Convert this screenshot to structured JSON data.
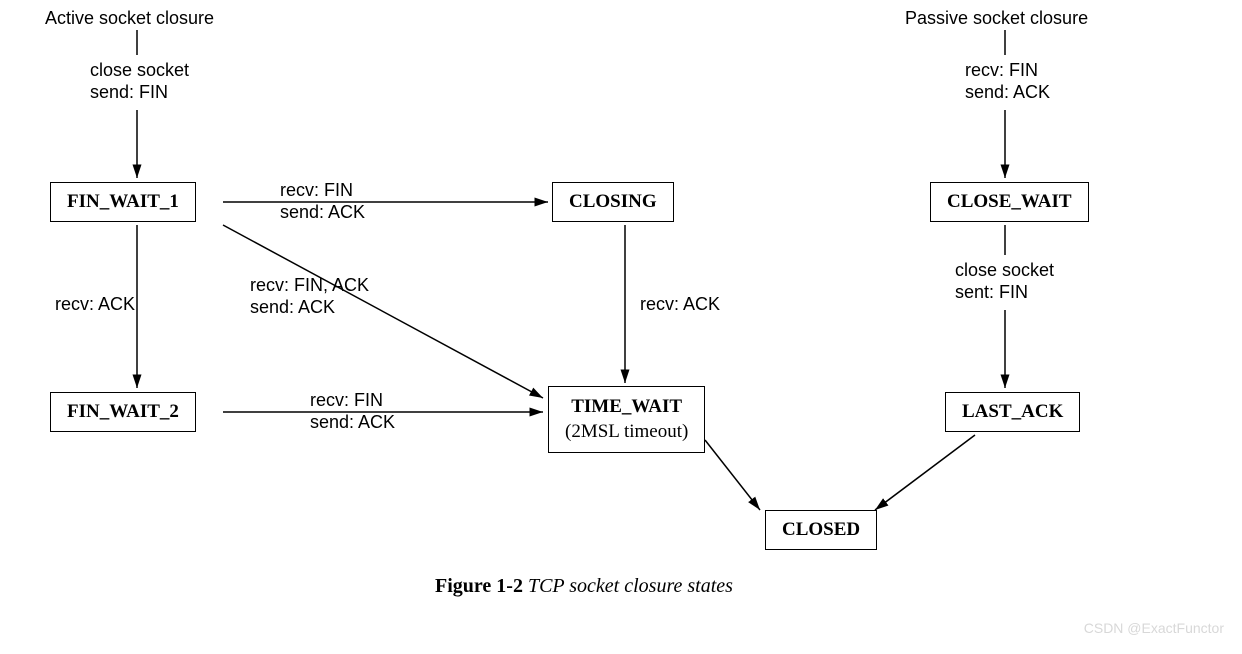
{
  "headers": {
    "active": "Active socket closure",
    "passive": "Passive socket closure"
  },
  "states": {
    "fin_wait_1": "FIN_WAIT_1",
    "fin_wait_2": "FIN_WAIT_2",
    "closing": "CLOSING",
    "time_wait_1": "TIME_WAIT",
    "time_wait_2": "(2MSL timeout)",
    "close_wait": "CLOSE_WAIT",
    "last_ack": "LAST_ACK",
    "closed": "CLOSED"
  },
  "edges": {
    "active_to_fw1_1": "close socket",
    "active_to_fw1_2": "send: FIN",
    "fw1_to_fw2": "recv: ACK",
    "fw1_to_closing_1": "recv: FIN",
    "fw1_to_closing_2": "send: ACK",
    "fw1_to_tw_1": "recv: FIN, ACK",
    "fw1_to_tw_2": "send: ACK",
    "fw2_to_tw_1": "recv: FIN",
    "fw2_to_tw_2": "send: ACK",
    "closing_to_tw": "recv: ACK",
    "passive_to_cw_1": "recv: FIN",
    "passive_to_cw_2": "send: ACK",
    "cw_to_la_1": "close socket",
    "cw_to_la_2": "sent: FIN"
  },
  "caption": {
    "figure": "Figure 1-2",
    "title": " TCP socket closure states"
  },
  "watermark": "CSDN @ExactFunctor"
}
